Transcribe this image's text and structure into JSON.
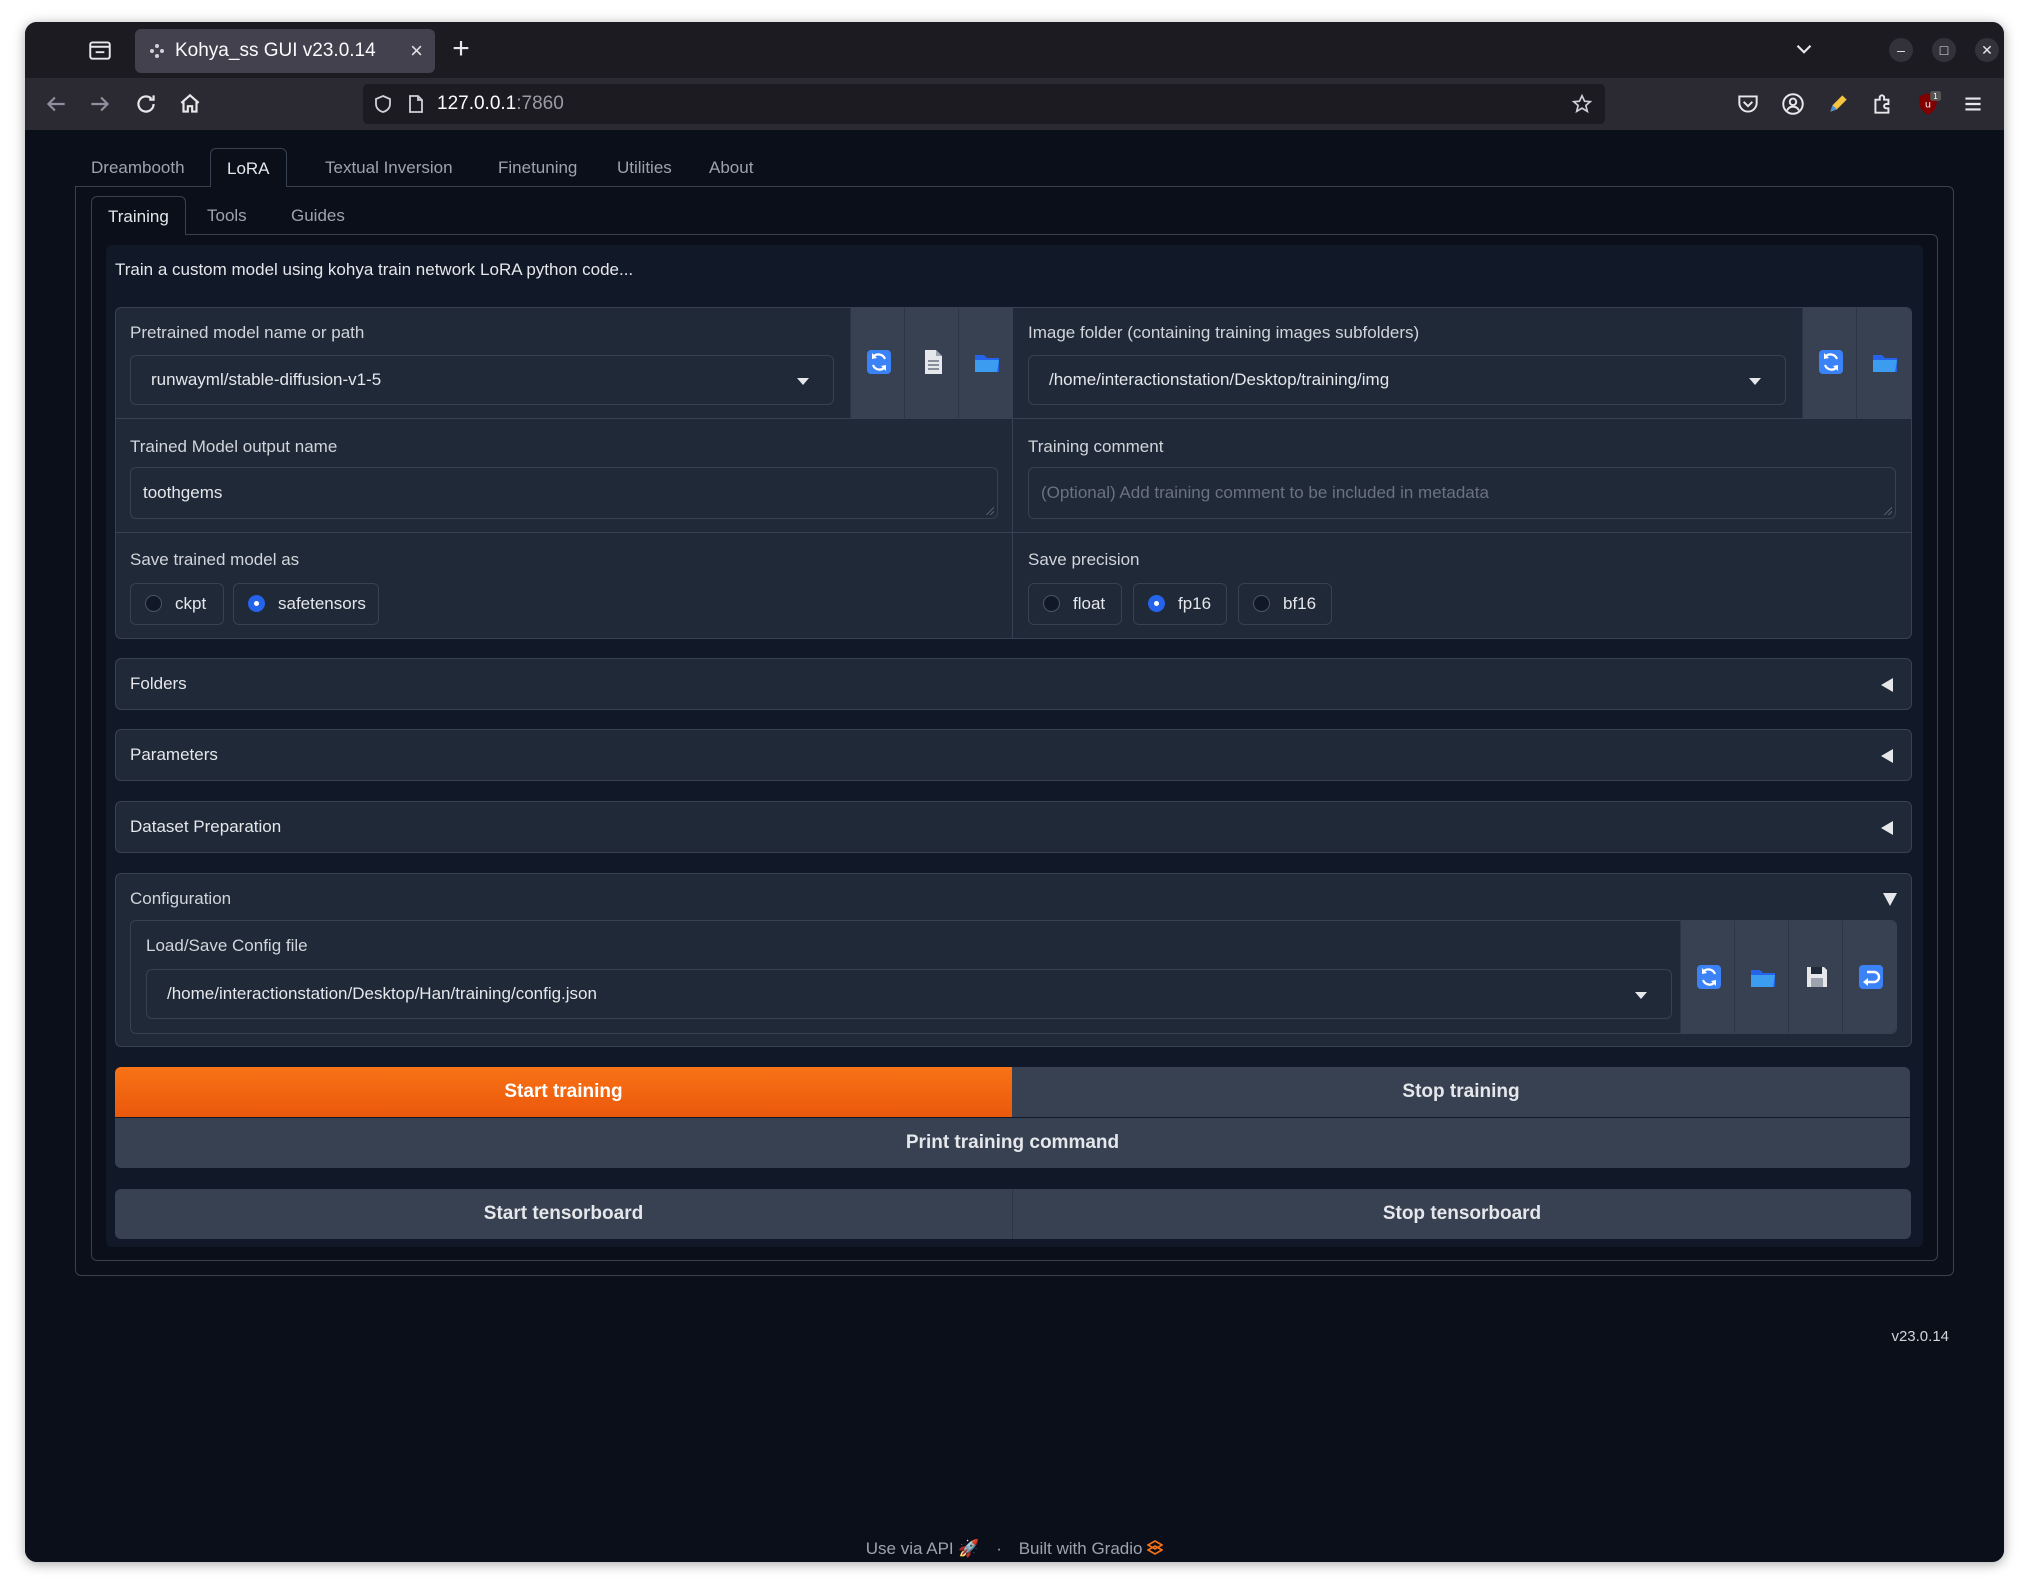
{
  "browser": {
    "tab_title": "Kohya_ss GUI v23.0.14",
    "url_host": "127.0.0.1",
    "url_port": ":7860",
    "notification_badge": "1"
  },
  "app": {
    "top_tabs": [
      "Dreambooth",
      "LoRA",
      "Textual Inversion",
      "Finetuning",
      "Utilities",
      "About"
    ],
    "active_top_tab": "LoRA",
    "sub_tabs": [
      "Training",
      "Tools",
      "Guides"
    ],
    "active_sub_tab": "Training",
    "description": "Train a custom model using kohya train network LoRA python code..."
  },
  "model": {
    "pretrained_label": "Pretrained model name or path",
    "pretrained_value": "runwayml/stable-diffusion-v1-5",
    "image_folder_label": "Image folder (containing training images subfolders)",
    "image_folder_value": "/home/interactionstation/Desktop/training/img",
    "output_name_label": "Trained Model output name",
    "output_name_value": "toothgems",
    "comment_label": "Training comment",
    "comment_placeholder": "(Optional) Add training comment to be included in metadata",
    "save_as_label": "Save trained model as",
    "save_as_options": [
      "ckpt",
      "safetensors"
    ],
    "save_as_selected": "safetensors",
    "precision_label": "Save precision",
    "precision_options": [
      "float",
      "fp16",
      "bf16"
    ],
    "precision_selected": "fp16"
  },
  "accordions": {
    "folders": "Folders",
    "parameters": "Parameters",
    "dataset": "Dataset Preparation",
    "configuration": "Configuration"
  },
  "config": {
    "label": "Load/Save Config file",
    "value": "/home/interactionstation/Desktop/Han/training/config.json"
  },
  "buttons": {
    "start_training": "Start training",
    "stop_training": "Stop training",
    "print_command": "Print training command",
    "start_tensorboard": "Start tensorboard",
    "stop_tensorboard": "Stop tensorboard"
  },
  "version": "v23.0.14",
  "footer": {
    "api": "Use via API",
    "separator": "·",
    "built": "Built with Gradio"
  },
  "colors": {
    "primary_button": "#f97316",
    "radio_selected": "#2563eb",
    "icon_blue": "#3b82f6"
  }
}
